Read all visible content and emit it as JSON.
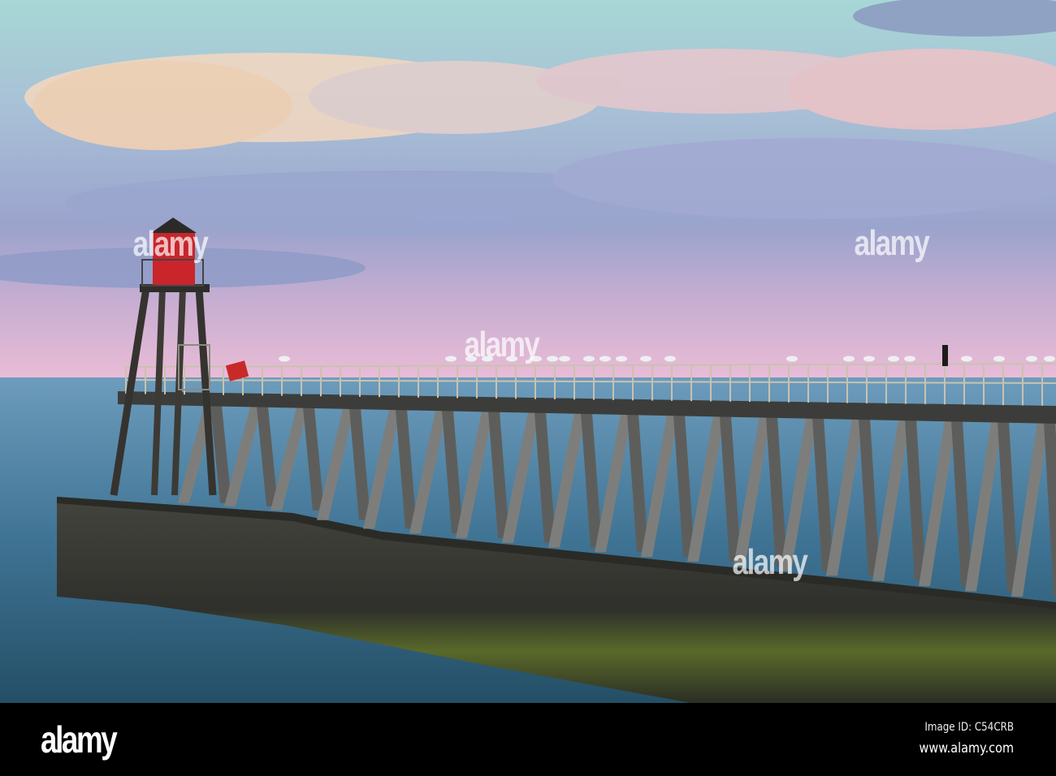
{
  "watermark": {
    "text": "alamy"
  },
  "footer": {
    "logo": "alamy",
    "image_id": "Image ID: C54CRB",
    "url": "www.alamy.com"
  }
}
